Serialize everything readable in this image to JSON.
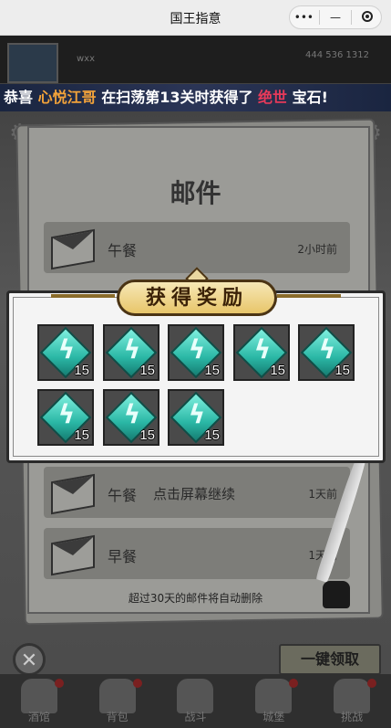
{
  "titlebar": {
    "title": "国王指意",
    "more_icon": "•••",
    "minimize_icon": "—",
    "close_icon": "record-circle"
  },
  "topbar": {
    "player_name": "wxx",
    "resource_text": "444 536 1312"
  },
  "banner": {
    "prefix": "恭喜",
    "player": "心悦江哥",
    "middle": "在扫荡第13关时获得了",
    "rarity": "绝世",
    "suffix": "宝石!"
  },
  "mail": {
    "title": "邮件",
    "rows": [
      {
        "subject": "午餐",
        "time": "2小时前"
      },
      {
        "subject": "午餐",
        "time": "1天前"
      },
      {
        "subject": "早餐",
        "time": "1天前"
      }
    ],
    "continue_hint": "点击屏幕继续",
    "footer_note": "超过30天的邮件将自动删除",
    "claim_all_label": "一键领取",
    "close_label": "✕"
  },
  "reward": {
    "title": "获得奖励",
    "items": [
      {
        "icon": "lightning-gem-icon",
        "quantity": "15"
      },
      {
        "icon": "lightning-gem-icon",
        "quantity": "15"
      },
      {
        "icon": "lightning-gem-icon",
        "quantity": "15"
      },
      {
        "icon": "lightning-gem-icon",
        "quantity": "15"
      },
      {
        "icon": "lightning-gem-icon",
        "quantity": "15"
      },
      {
        "icon": "lightning-gem-icon",
        "quantity": "15"
      },
      {
        "icon": "lightning-gem-icon",
        "quantity": "15"
      },
      {
        "icon": "lightning-gem-icon",
        "quantity": "15"
      }
    ]
  },
  "bottom_nav": [
    {
      "label": "酒馆",
      "badge": true
    },
    {
      "label": "背包",
      "badge": true
    },
    {
      "label": "战斗",
      "badge": false
    },
    {
      "label": "城堡",
      "badge": true
    },
    {
      "label": "挑战",
      "badge": true
    }
  ],
  "colors": {
    "banner_highlight": "#f3a33a",
    "rarity_highlight": "#e83a5a",
    "gem": "#2bb8a6",
    "reward_header": "#e8c66a"
  }
}
